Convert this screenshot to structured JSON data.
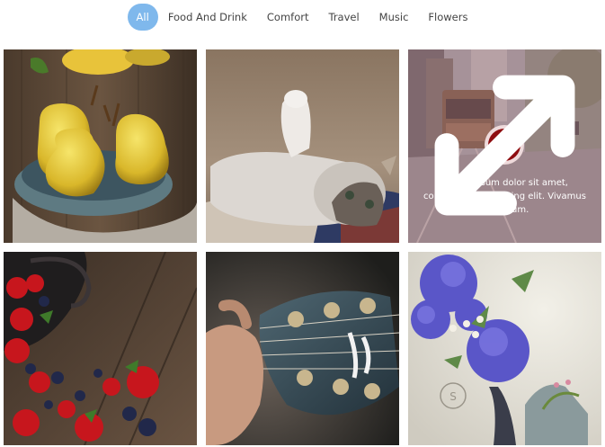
{
  "filters": [
    {
      "label": "All",
      "active": true
    },
    {
      "label": "Food And Drink",
      "active": false
    },
    {
      "label": "Comfort",
      "active": false
    },
    {
      "label": "Travel",
      "active": false
    },
    {
      "label": "Music",
      "active": false
    },
    {
      "label": "Flowers",
      "active": false
    }
  ],
  "gallery": {
    "hover_caption": "Lorem ipsum dolor sit amet, consectetur adipiscing elit. Vivamus bibendum.",
    "items": [
      {
        "subject": "pears"
      },
      {
        "subject": "cat"
      },
      {
        "subject": "city-tram"
      },
      {
        "subject": "berries"
      },
      {
        "subject": "guitar"
      },
      {
        "subject": "flowers"
      }
    ]
  },
  "colors": {
    "active_filter": "#7fb8ec",
    "zoom_button": "#8e0d10"
  }
}
